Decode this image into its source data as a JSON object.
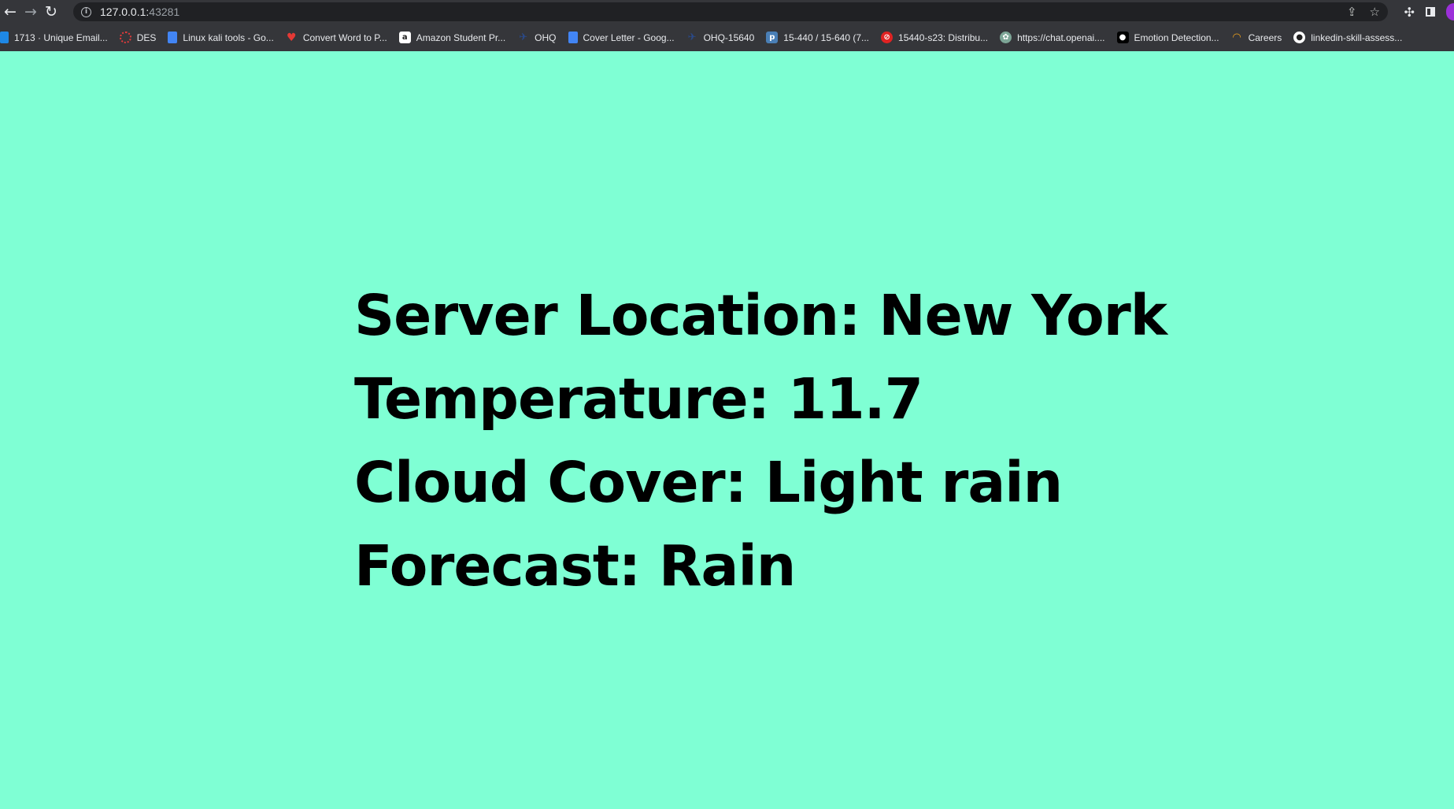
{
  "browser": {
    "url_host": "127.0.0.1:",
    "url_port": "43281",
    "bookmarks": [
      {
        "label": "1713 · Unique Email...",
        "icon": "leetcode-icon"
      },
      {
        "label": "DES",
        "icon": "circle-icon"
      },
      {
        "label": "Linux kali tools - Go...",
        "icon": "google-docs-icon"
      },
      {
        "label": "Convert Word to P...",
        "icon": "heart-icon"
      },
      {
        "label": "Amazon Student Pr...",
        "icon": "amazon-icon"
      },
      {
        "label": "OHQ",
        "icon": "ohq-icon"
      },
      {
        "label": "Cover Letter - Goog...",
        "icon": "google-docs-icon"
      },
      {
        "label": "OHQ-15640",
        "icon": "ohq-icon"
      },
      {
        "label": "15-440 / 15-640 (7...",
        "icon": "piazza-icon"
      },
      {
        "label": "15440-s23: Distribu...",
        "icon": "no-entry-icon"
      },
      {
        "label": "https://chat.openai....",
        "icon": "openai-icon"
      },
      {
        "label": "Emotion Detection...",
        "icon": "medium-icon"
      },
      {
        "label": "Careers",
        "icon": "careers-icon"
      },
      {
        "label": "linkedin-skill-assess...",
        "icon": "github-icon"
      }
    ]
  },
  "weather": {
    "location_line": "Server Location: New York",
    "temperature_line": "Temperature: 11.7",
    "cloud_line": "Cloud Cover: Light rain",
    "forecast_line": "Forecast: Rain"
  },
  "colors": {
    "page_background": "#7fffd4",
    "chrome_background": "#35363a"
  }
}
